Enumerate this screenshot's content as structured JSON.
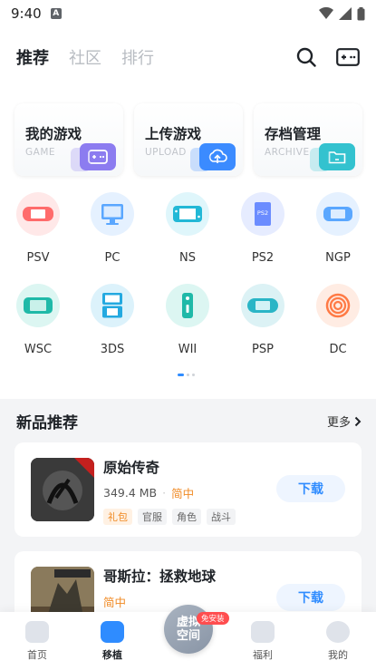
{
  "status_bar": {
    "time": "9:40",
    "app_badge": "A"
  },
  "header": {
    "tabs": [
      {
        "label": "推荐",
        "active": true
      },
      {
        "label": "社区",
        "active": false
      },
      {
        "label": "排行",
        "active": false
      }
    ],
    "icons": [
      "search-icon",
      "gamepad-icon"
    ]
  },
  "quick_cards": [
    {
      "title": "我的游戏",
      "subtitle": "GAME",
      "icon": "gamepad-icon",
      "color": "#8c7cf0"
    },
    {
      "title": "上传游戏",
      "subtitle": "UPLOAD",
      "icon": "cloud-upload-icon",
      "color": "#3b8bff"
    },
    {
      "title": "存档管理",
      "subtitle": "ARCHIVE",
      "icon": "folder-icon",
      "color": "#33c2cf"
    }
  ],
  "platforms": [
    {
      "label": "PSV",
      "color": "#ff6b6b"
    },
    {
      "label": "PC",
      "color": "#5aa7ff"
    },
    {
      "label": "NS",
      "color": "#22b8d6"
    },
    {
      "label": "PS2",
      "color": "#6b8cff"
    },
    {
      "label": "NGP",
      "color": "#5aa7ff"
    },
    {
      "label": "WSC",
      "color": "#1fb9a8"
    },
    {
      "label": "3DS",
      "color": "#24a9e0"
    },
    {
      "label": "WII",
      "color": "#1fb9a8"
    },
    {
      "label": "PSP",
      "color": "#2ab5c6"
    },
    {
      "label": "DC",
      "color": "#ff7a45"
    }
  ],
  "section": {
    "title": "新品推荐",
    "more": "更多"
  },
  "games": [
    {
      "name": "原始传奇",
      "size": "349.4 MB",
      "lang": "简中",
      "tags": [
        "礼包",
        "官服",
        "角色",
        "战斗"
      ],
      "button": "下载"
    },
    {
      "name": "哥斯拉：拯救地球",
      "lang": "简中",
      "button": "下载"
    }
  ],
  "bottom_nav": {
    "items": [
      {
        "label": "首页",
        "active": false
      },
      {
        "label": "移植",
        "active": true
      },
      {
        "label": "福利",
        "active": false
      },
      {
        "label": "我的",
        "active": false
      }
    ],
    "center": {
      "label_line1": "虚拟",
      "label_line2": "空间",
      "badge": "免安装"
    }
  },
  "colors": {
    "accent": "#2f8cff",
    "orange": "#f08a24"
  }
}
